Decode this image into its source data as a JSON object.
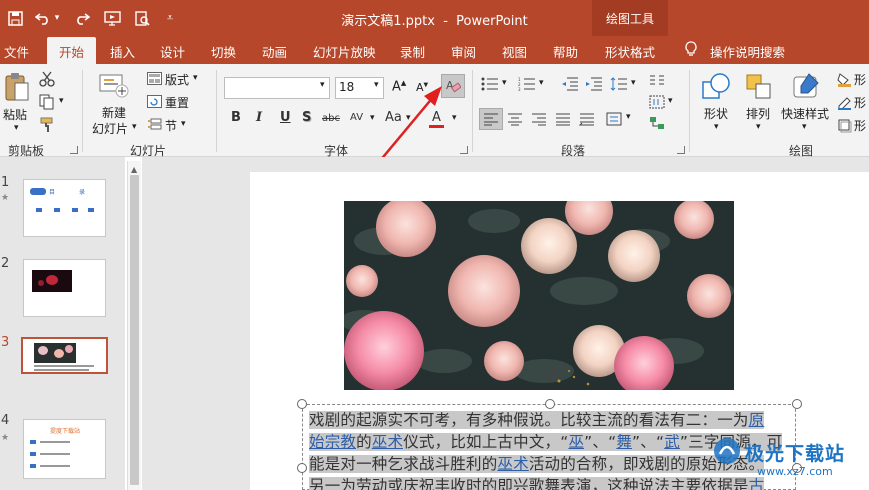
{
  "title": {
    "doc": "演示文稿1.pptx",
    "sep": "-",
    "app": "PowerPoint",
    "context_group": "绘图工具"
  },
  "tabs": [
    "文件",
    "开始",
    "插入",
    "设计",
    "切换",
    "动画",
    "幻灯片放映",
    "录制",
    "审阅",
    "视图",
    "帮助",
    "形状格式"
  ],
  "tell_me": "操作说明搜索",
  "clipboard": {
    "paste": "粘贴",
    "group": "剪贴板"
  },
  "slides_grp": {
    "new_line1": "新建",
    "new_line2": "幻灯片",
    "layout": "版式",
    "reset": "重置",
    "section": "节",
    "group": "幻灯片"
  },
  "font": {
    "size": "18",
    "group": "字体",
    "bold": "B",
    "italic": "I",
    "underline": "U",
    "shadow": "S",
    "strike": "abc",
    "spacing": "AV",
    "case": "Aa",
    "color": "A"
  },
  "paragraph": {
    "group": "段落"
  },
  "drawing": {
    "shape": "形状",
    "arrange": "排列",
    "quick_style": "快速样式",
    "group": "绘图",
    "fill": "形",
    "outline": "形",
    "effect": "形"
  },
  "thumbs": [
    {
      "num": "1",
      "star": "★",
      "mini_a": "目",
      "mini_b": "录"
    },
    {
      "num": "2",
      "star": ""
    },
    {
      "num": "3",
      "star": ""
    },
    {
      "num": "4",
      "star": "★",
      "mini_title": "提度下载站"
    }
  ],
  "body": {
    "l1_a": "戏剧的起源实不可考，有多种假说。比较主流的看法有二：一为",
    "l1_link": "原",
    "l2_link1": "始宗教",
    "l2_a": "的",
    "l2_link2": "巫术",
    "l2_b": "仪式，比如上古中文，“",
    "l2_c1": "巫",
    "l2_c2": "”、“",
    "l2_c3": "舞",
    "l2_c4": "”、“",
    "l2_c5": "武",
    "l2_c6": "”三字同源，可",
    "l3_a": "能是对一种乞求战斗胜利的",
    "l3_link": "巫术",
    "l3_b": "活动的合称，即戏剧的原始形态。",
    "l4_a": "另一为劳动或庆祝丰收时的即兴歌舞表演，这种说法主要依据是",
    "l4_link": "古"
  },
  "watermark": {
    "name": "极光下载站",
    "url": "www.xz7.com"
  },
  "colors": {
    "brand": "#b7472a",
    "link": "#2f5ea8",
    "arrow": "#e02020"
  }
}
